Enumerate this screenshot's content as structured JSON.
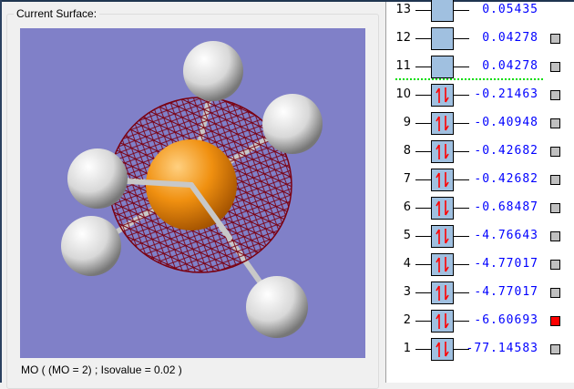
{
  "panel": {
    "group_label": "Current Surface:",
    "status": "MO ( (MO = 2) ; Isovalue = 0.02 )"
  },
  "colors": {
    "background": "#8080c8",
    "selected": "#ff0000",
    "unselected": "#c0c0c0",
    "homo_lumo_line": "#00dd00"
  },
  "orbitals": [
    {
      "n": "13",
      "energy": "0.05435",
      "occupied": false,
      "selected": false,
      "square": false
    },
    {
      "n": "12",
      "energy": "0.04278",
      "occupied": false,
      "selected": false,
      "square": true
    },
    {
      "n": "11",
      "energy": "0.04278",
      "occupied": false,
      "selected": false,
      "square": true
    },
    {
      "n": "10",
      "energy": "-0.21463",
      "occupied": true,
      "selected": false,
      "square": true
    },
    {
      "n": "9",
      "energy": "-0.40948",
      "occupied": true,
      "selected": false,
      "square": true
    },
    {
      "n": "8",
      "energy": "-0.42682",
      "occupied": true,
      "selected": false,
      "square": true
    },
    {
      "n": "7",
      "energy": "-0.42682",
      "occupied": true,
      "selected": false,
      "square": true
    },
    {
      "n": "6",
      "energy": "-0.68487",
      "occupied": true,
      "selected": false,
      "square": true
    },
    {
      "n": "5",
      "energy": "-4.76643",
      "occupied": true,
      "selected": false,
      "square": true
    },
    {
      "n": "4",
      "energy": "-4.77017",
      "occupied": true,
      "selected": false,
      "square": true
    },
    {
      "n": "3",
      "energy": "-4.77017",
      "occupied": true,
      "selected": false,
      "square": true
    },
    {
      "n": "2",
      "energy": "-6.60693",
      "occupied": true,
      "selected": true,
      "square": true
    },
    {
      "n": "1",
      "energy": "-77.14583",
      "occupied": true,
      "selected": false,
      "square": true
    }
  ]
}
